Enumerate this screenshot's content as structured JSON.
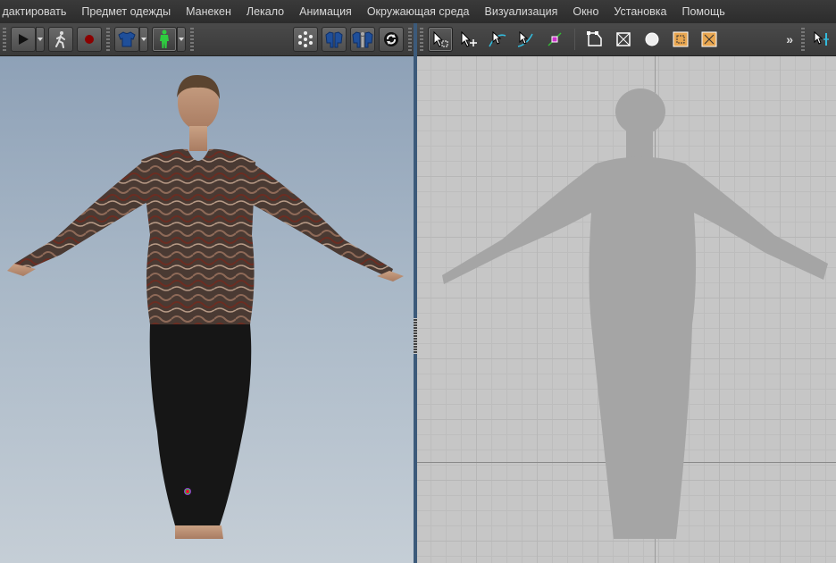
{
  "menu": {
    "items": [
      "дактировать",
      "Предмет одежды",
      "Манекен",
      "Лекало",
      "Анимация",
      "Окружающая среда",
      "Визуализация",
      "Окно",
      "Установка",
      "Помощь"
    ]
  },
  "toolbar_left": {
    "buttons": [
      "play-icon",
      "walk-icon",
      "record-icon",
      "shirt-icon",
      "avatar-icon",
      "points-icon",
      "garment-icon",
      "garment-avatar-icon",
      "refresh-icon"
    ]
  },
  "toolbar_right": {
    "buttons": [
      "select-icon",
      "select-transform-icon",
      "edit-curve-icon",
      "edit-point-icon",
      "add-point-icon",
      "polygon-icon",
      "rectangle-icon",
      "circle-icon",
      "internal-rect-icon",
      "internal-rect-x-icon",
      "segment-tool-icon"
    ],
    "overflow_label": "»"
  },
  "colors": {
    "accent": "#3c5a7a",
    "bg_3d_top": "#8ea1b7",
    "bg_3d_bottom": "#c5ced6",
    "bg_2d": "#c6c6c6"
  }
}
